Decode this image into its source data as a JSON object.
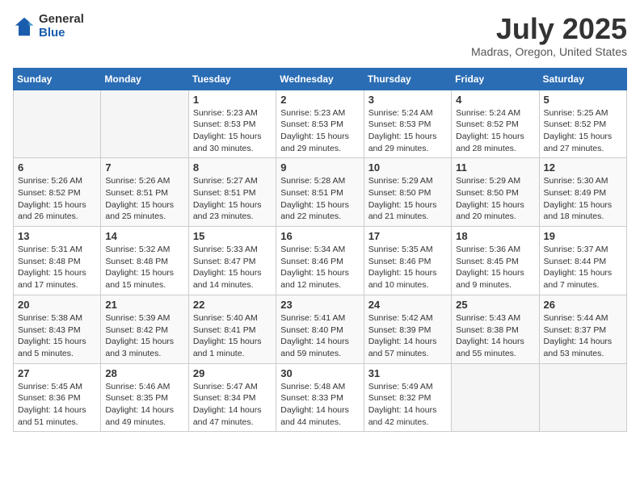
{
  "header": {
    "logo_general": "General",
    "logo_blue": "Blue",
    "month_year": "July 2025",
    "location": "Madras, Oregon, United States"
  },
  "weekdays": [
    "Sunday",
    "Monday",
    "Tuesday",
    "Wednesday",
    "Thursday",
    "Friday",
    "Saturday"
  ],
  "weeks": [
    [
      {
        "day": "",
        "info": ""
      },
      {
        "day": "",
        "info": ""
      },
      {
        "day": "1",
        "info": "Sunrise: 5:23 AM\nSunset: 8:53 PM\nDaylight: 15 hours\nand 30 minutes."
      },
      {
        "day": "2",
        "info": "Sunrise: 5:23 AM\nSunset: 8:53 PM\nDaylight: 15 hours\nand 29 minutes."
      },
      {
        "day": "3",
        "info": "Sunrise: 5:24 AM\nSunset: 8:53 PM\nDaylight: 15 hours\nand 29 minutes."
      },
      {
        "day": "4",
        "info": "Sunrise: 5:24 AM\nSunset: 8:52 PM\nDaylight: 15 hours\nand 28 minutes."
      },
      {
        "day": "5",
        "info": "Sunrise: 5:25 AM\nSunset: 8:52 PM\nDaylight: 15 hours\nand 27 minutes."
      }
    ],
    [
      {
        "day": "6",
        "info": "Sunrise: 5:26 AM\nSunset: 8:52 PM\nDaylight: 15 hours\nand 26 minutes."
      },
      {
        "day": "7",
        "info": "Sunrise: 5:26 AM\nSunset: 8:51 PM\nDaylight: 15 hours\nand 25 minutes."
      },
      {
        "day": "8",
        "info": "Sunrise: 5:27 AM\nSunset: 8:51 PM\nDaylight: 15 hours\nand 23 minutes."
      },
      {
        "day": "9",
        "info": "Sunrise: 5:28 AM\nSunset: 8:51 PM\nDaylight: 15 hours\nand 22 minutes."
      },
      {
        "day": "10",
        "info": "Sunrise: 5:29 AM\nSunset: 8:50 PM\nDaylight: 15 hours\nand 21 minutes."
      },
      {
        "day": "11",
        "info": "Sunrise: 5:29 AM\nSunset: 8:50 PM\nDaylight: 15 hours\nand 20 minutes."
      },
      {
        "day": "12",
        "info": "Sunrise: 5:30 AM\nSunset: 8:49 PM\nDaylight: 15 hours\nand 18 minutes."
      }
    ],
    [
      {
        "day": "13",
        "info": "Sunrise: 5:31 AM\nSunset: 8:48 PM\nDaylight: 15 hours\nand 17 minutes."
      },
      {
        "day": "14",
        "info": "Sunrise: 5:32 AM\nSunset: 8:48 PM\nDaylight: 15 hours\nand 15 minutes."
      },
      {
        "day": "15",
        "info": "Sunrise: 5:33 AM\nSunset: 8:47 PM\nDaylight: 15 hours\nand 14 minutes."
      },
      {
        "day": "16",
        "info": "Sunrise: 5:34 AM\nSunset: 8:46 PM\nDaylight: 15 hours\nand 12 minutes."
      },
      {
        "day": "17",
        "info": "Sunrise: 5:35 AM\nSunset: 8:46 PM\nDaylight: 15 hours\nand 10 minutes."
      },
      {
        "day": "18",
        "info": "Sunrise: 5:36 AM\nSunset: 8:45 PM\nDaylight: 15 hours\nand 9 minutes."
      },
      {
        "day": "19",
        "info": "Sunrise: 5:37 AM\nSunset: 8:44 PM\nDaylight: 15 hours\nand 7 minutes."
      }
    ],
    [
      {
        "day": "20",
        "info": "Sunrise: 5:38 AM\nSunset: 8:43 PM\nDaylight: 15 hours\nand 5 minutes."
      },
      {
        "day": "21",
        "info": "Sunrise: 5:39 AM\nSunset: 8:42 PM\nDaylight: 15 hours\nand 3 minutes."
      },
      {
        "day": "22",
        "info": "Sunrise: 5:40 AM\nSunset: 8:41 PM\nDaylight: 15 hours\nand 1 minute."
      },
      {
        "day": "23",
        "info": "Sunrise: 5:41 AM\nSunset: 8:40 PM\nDaylight: 14 hours\nand 59 minutes."
      },
      {
        "day": "24",
        "info": "Sunrise: 5:42 AM\nSunset: 8:39 PM\nDaylight: 14 hours\nand 57 minutes."
      },
      {
        "day": "25",
        "info": "Sunrise: 5:43 AM\nSunset: 8:38 PM\nDaylight: 14 hours\nand 55 minutes."
      },
      {
        "day": "26",
        "info": "Sunrise: 5:44 AM\nSunset: 8:37 PM\nDaylight: 14 hours\nand 53 minutes."
      }
    ],
    [
      {
        "day": "27",
        "info": "Sunrise: 5:45 AM\nSunset: 8:36 PM\nDaylight: 14 hours\nand 51 minutes."
      },
      {
        "day": "28",
        "info": "Sunrise: 5:46 AM\nSunset: 8:35 PM\nDaylight: 14 hours\nand 49 minutes."
      },
      {
        "day": "29",
        "info": "Sunrise: 5:47 AM\nSunset: 8:34 PM\nDaylight: 14 hours\nand 47 minutes."
      },
      {
        "day": "30",
        "info": "Sunrise: 5:48 AM\nSunset: 8:33 PM\nDaylight: 14 hours\nand 44 minutes."
      },
      {
        "day": "31",
        "info": "Sunrise: 5:49 AM\nSunset: 8:32 PM\nDaylight: 14 hours\nand 42 minutes."
      },
      {
        "day": "",
        "info": ""
      },
      {
        "day": "",
        "info": ""
      }
    ]
  ]
}
